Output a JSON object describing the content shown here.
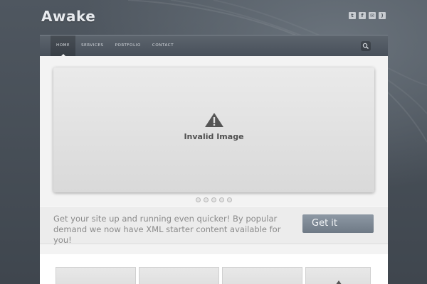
{
  "header": {
    "logo": "Awake",
    "social_icons": [
      "twitter-icon",
      "facebook-icon",
      "email-icon",
      "rss-icon"
    ]
  },
  "nav": {
    "items": [
      {
        "label": "HOME"
      },
      {
        "label": "SERVICES"
      },
      {
        "label": "PORTFOLIO"
      },
      {
        "label": "CONTACT"
      }
    ],
    "search_icon": "search-icon"
  },
  "slider": {
    "icon": "warning-icon",
    "message": "Invalid Image",
    "pages": 5
  },
  "promo": {
    "text": "Get your site up and running even quicker! By popular demand we now have XML starter content available for you!",
    "button_label": "Get it"
  },
  "colors": {
    "background": "#444b53",
    "nav": "#525a63",
    "button": "#7d8894"
  }
}
